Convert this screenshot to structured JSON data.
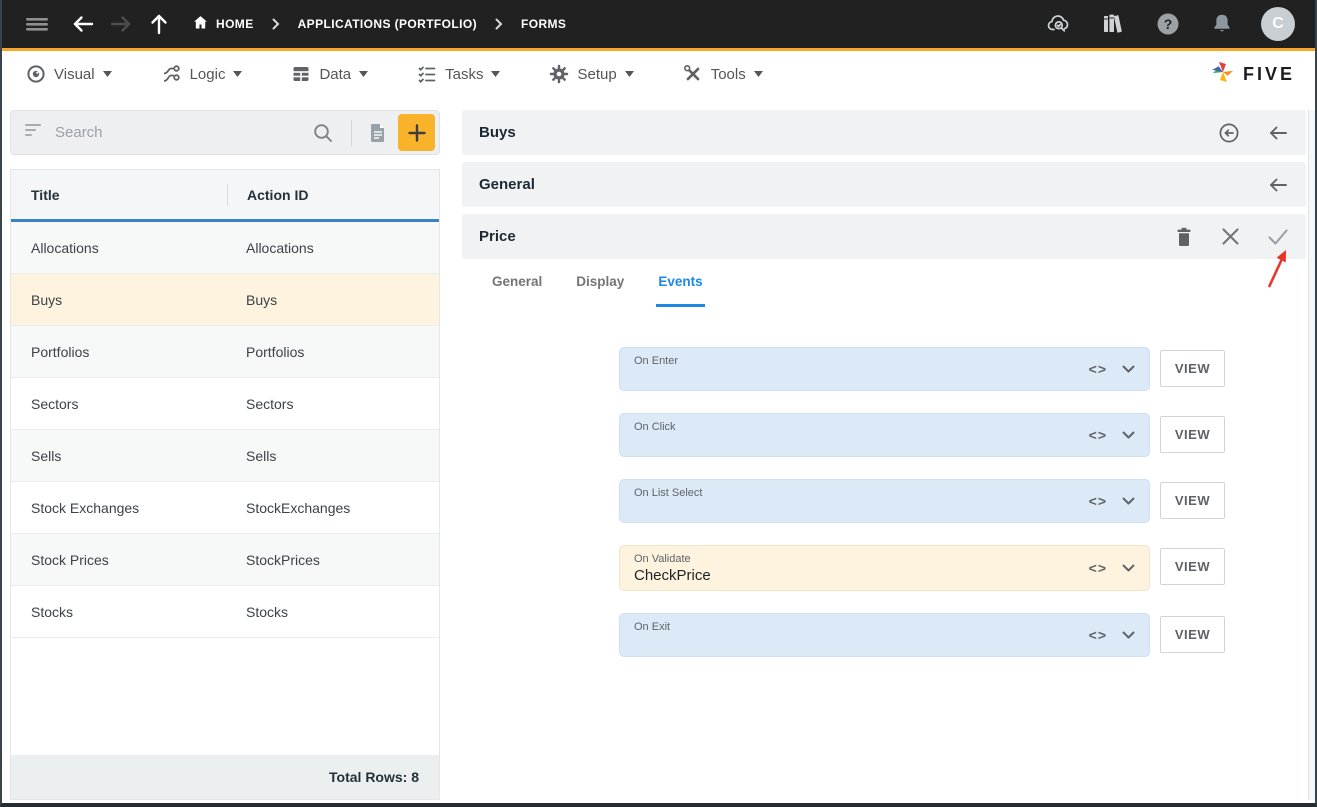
{
  "colors": {
    "topbar_bg": "#212121",
    "accent_amber": "#f9a72b",
    "button_amber": "#f9b32a",
    "selected_row_bg": "#fdf3de",
    "field_blue_bg": "#dce9f7",
    "field_cream_bg": "#fdf3de",
    "tab_active_blue": "#1e88e5",
    "table_header_blue": "#3c80c8",
    "annotation_red": "#e8352b"
  },
  "topbar": {
    "breadcrumb": [
      {
        "label": "HOME"
      },
      {
        "label": "APPLICATIONS (PORTFOLIO)"
      },
      {
        "label": "FORMS"
      }
    ],
    "avatar_initial": "C"
  },
  "menubar": {
    "items": [
      {
        "label": "Visual"
      },
      {
        "label": "Logic"
      },
      {
        "label": "Data"
      },
      {
        "label": "Tasks"
      },
      {
        "label": "Setup"
      },
      {
        "label": "Tools"
      }
    ],
    "logo_text": "FIVE"
  },
  "left_panel": {
    "search_placeholder": "Search",
    "table": {
      "columns": [
        {
          "label": "Title"
        },
        {
          "label": "Action ID"
        }
      ],
      "rows": [
        {
          "title": "Allocations",
          "action_id": "Allocations",
          "selected": false
        },
        {
          "title": "Buys",
          "action_id": "Buys",
          "selected": true
        },
        {
          "title": "Portfolios",
          "action_id": "Portfolios",
          "selected": false
        },
        {
          "title": "Sectors",
          "action_id": "Sectors",
          "selected": false
        },
        {
          "title": "Sells",
          "action_id": "Sells",
          "selected": false
        },
        {
          "title": "Stock Exchanges",
          "action_id": "StockExchanges",
          "selected": false
        },
        {
          "title": "Stock Prices",
          "action_id": "StockPrices",
          "selected": false
        },
        {
          "title": "Stocks",
          "action_id": "Stocks",
          "selected": false
        }
      ],
      "footer_total": "Total Rows: 8"
    }
  },
  "right_panel": {
    "record_title": "Buys",
    "section_title": "General",
    "card": {
      "title": "Price",
      "tabs": [
        {
          "label": "General",
          "active": false
        },
        {
          "label": "Display",
          "active": false
        },
        {
          "label": "Events",
          "active": true
        }
      ],
      "fields": [
        {
          "label": "On Enter",
          "value": "",
          "highlighted": false
        },
        {
          "label": "On Click",
          "value": "",
          "highlighted": false
        },
        {
          "label": "On List Select",
          "value": "",
          "highlighted": false
        },
        {
          "label": "On Validate",
          "value": "CheckPrice",
          "highlighted": true
        },
        {
          "label": "On Exit",
          "value": "",
          "highlighted": false
        }
      ],
      "view_button_label": "VIEW"
    }
  }
}
